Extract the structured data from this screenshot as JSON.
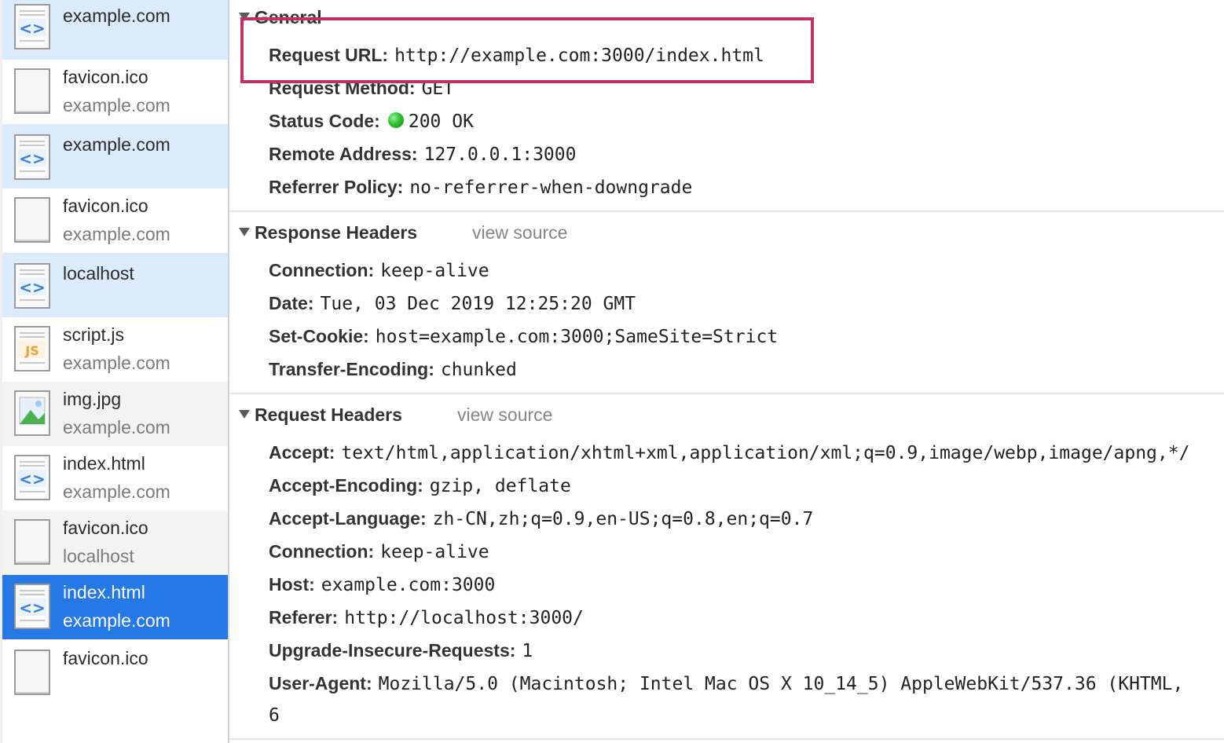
{
  "requests": [
    {
      "name": "example.com",
      "domain": "",
      "icon": "html-document-icon"
    },
    {
      "name": "favicon.ico",
      "domain": "example.com",
      "icon": "blank-file-icon"
    },
    {
      "name": "example.com",
      "domain": "",
      "icon": "html-document-icon"
    },
    {
      "name": "favicon.ico",
      "domain": "example.com",
      "icon": "blank-file-icon"
    },
    {
      "name": "localhost",
      "domain": "",
      "icon": "html-document-icon"
    },
    {
      "name": "script.js",
      "domain": "example.com",
      "icon": "js-file-icon",
      "badge": "JS"
    },
    {
      "name": "img.jpg",
      "domain": "example.com",
      "icon": "image-file-icon"
    },
    {
      "name": "index.html",
      "domain": "example.com",
      "icon": "html-document-icon"
    },
    {
      "name": "favicon.ico",
      "domain": "localhost",
      "icon": "blank-file-icon"
    },
    {
      "name": "index.html",
      "domain": "example.com",
      "icon": "html-document-icon",
      "selected": true
    },
    {
      "name": "favicon.ico",
      "domain": "",
      "icon": "blank-file-icon"
    }
  ],
  "general": {
    "title": "General",
    "rows": [
      {
        "key": "Request URL:",
        "value": "http://example.com:3000/index.html"
      },
      {
        "key": "Request Method:",
        "value": "GET"
      },
      {
        "key": "Status Code:",
        "value": "200 OK"
      },
      {
        "key": "Remote Address:",
        "value": "127.0.0.1:3000"
      },
      {
        "key": "Referrer Policy:",
        "value": "no-referrer-when-downgrade"
      }
    ]
  },
  "response_headers": {
    "title": "Response Headers",
    "view_source": "view source",
    "rows": [
      {
        "key": "Connection:",
        "value": "keep-alive"
      },
      {
        "key": "Date:",
        "value": "Tue, 03 Dec 2019 12:25:20 GMT"
      },
      {
        "key": "Set-Cookie:",
        "value": "host=example.com:3000;SameSite=Strict"
      },
      {
        "key": "Transfer-Encoding:",
        "value": "chunked"
      }
    ]
  },
  "request_headers": {
    "title": "Request Headers",
    "view_source": "view source",
    "rows": [
      {
        "key": "Accept:",
        "value": "text/html,application/xhtml+xml,application/xml;q=0.9,image/webp,image/apng,*/"
      },
      {
        "key": "Accept-Encoding:",
        "value": "gzip, deflate"
      },
      {
        "key": "Accept-Language:",
        "value": "zh-CN,zh;q=0.9,en-US;q=0.8,en;q=0.7"
      },
      {
        "key": "Connection:",
        "value": "keep-alive"
      },
      {
        "key": "Host:",
        "value": "example.com:3000"
      },
      {
        "key": "Referer:",
        "value": "http://localhost:3000/"
      },
      {
        "key": "Upgrade-Insecure-Requests:",
        "value": "1"
      },
      {
        "key": "User-Agent:",
        "value": "Mozilla/5.0 (Macintosh; Intel Mac OS X 10_14_5) AppleWebKit/537.36 (KHTML,"
      },
      {
        "key": "",
        "value": "6"
      }
    ]
  },
  "colors": {
    "selected_row": "#2579e6",
    "redirect_row": "#dcebfb",
    "highlight_box": "#c0335f",
    "status_ok": "#2fc02f"
  }
}
